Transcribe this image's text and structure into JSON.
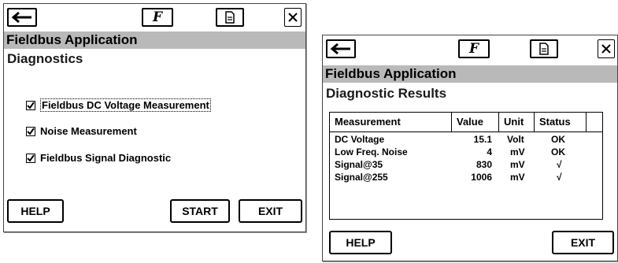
{
  "screen1": {
    "toolbar": {
      "back_icon": "arrow-left-icon",
      "fieldbus_glyph": "F",
      "doc_icon": "document-icon",
      "close_icon": "close-icon"
    },
    "app_title": "Fieldbus Application",
    "subtitle": "Diagnostics",
    "options": [
      {
        "label": "Fieldbus DC Voltage Measurement",
        "checked": true
      },
      {
        "label": "Noise Measurement",
        "checked": true
      },
      {
        "label": "Fieldbus Signal Diagnostic",
        "checked": true
      }
    ],
    "buttons": {
      "help": "HELP",
      "start": "START",
      "exit": "EXIT"
    }
  },
  "screen2": {
    "toolbar": {
      "back_icon": "arrow-left-icon",
      "fieldbus_glyph": "F",
      "doc_icon": "document-icon",
      "close_icon": "close-icon"
    },
    "app_title": "Fieldbus Application",
    "subtitle": "Diagnostic Results",
    "table": {
      "headers": [
        "Measurement",
        "Value",
        "Unit",
        "Status"
      ],
      "rows": [
        [
          "DC Voltage",
          "15.1",
          "Volt",
          "OK"
        ],
        [
          "Low Freq. Noise",
          "4",
          "mV",
          "OK"
        ],
        [
          "Signal@35",
          "830",
          "mV",
          "√"
        ],
        [
          "Signal@255",
          "1006",
          "mV",
          "√"
        ]
      ]
    },
    "buttons": {
      "help": "HELP",
      "exit": "EXIT"
    }
  }
}
